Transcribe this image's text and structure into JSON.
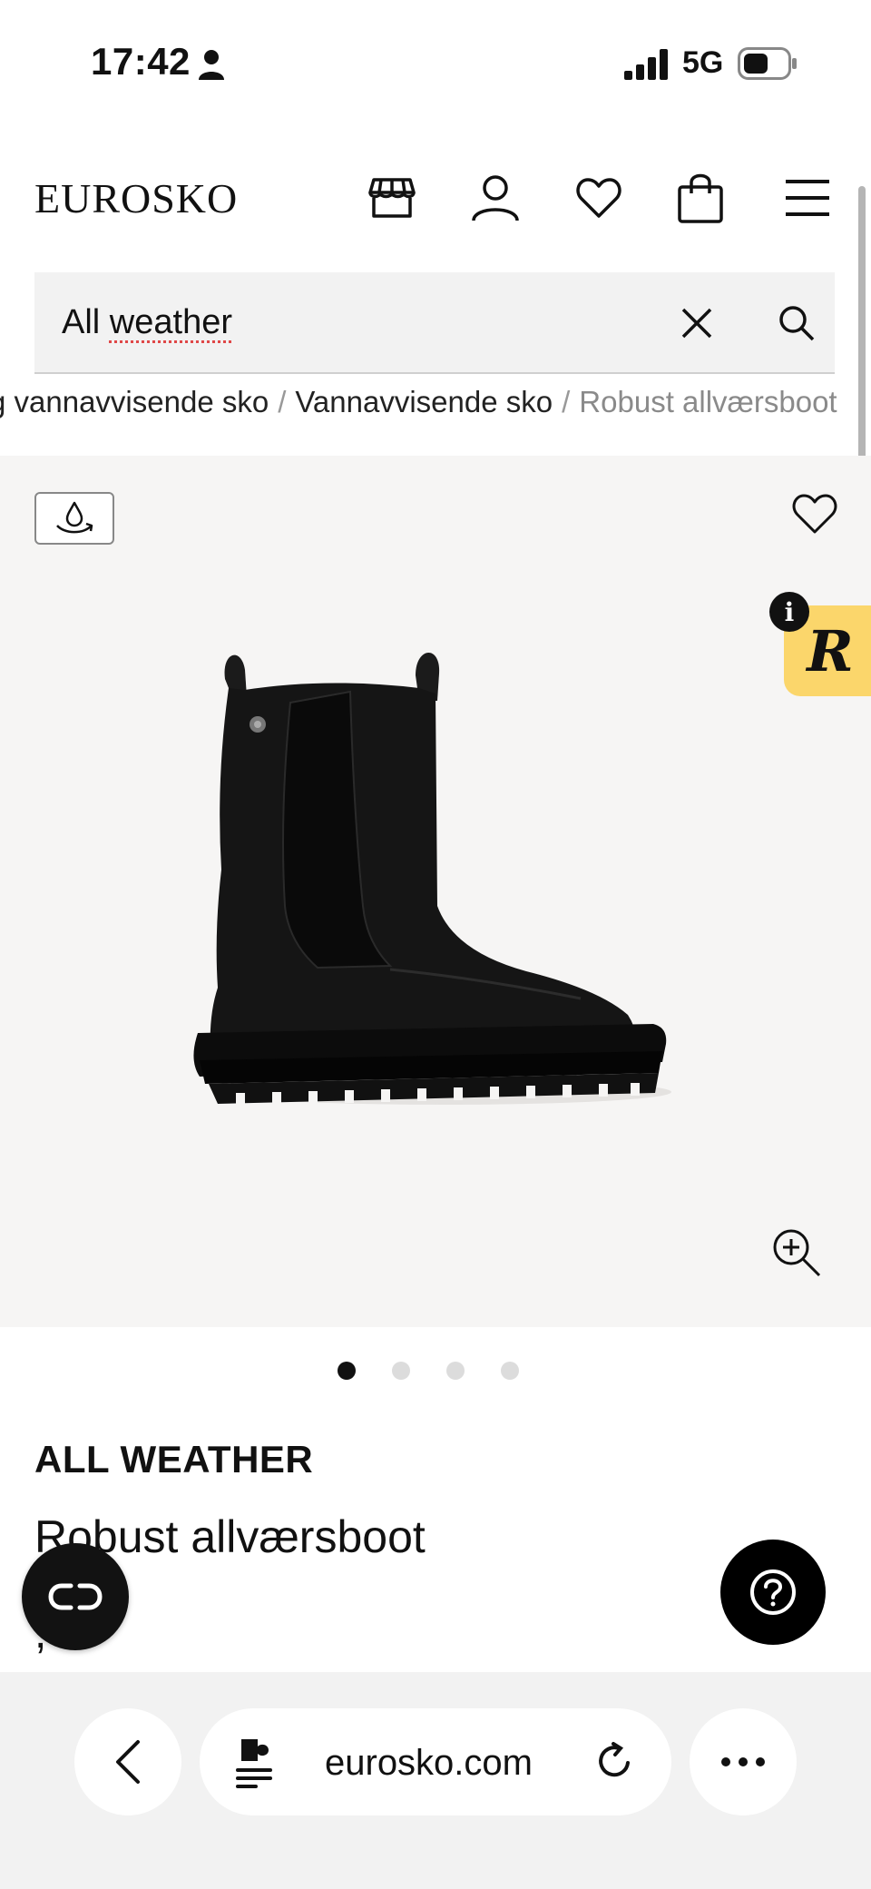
{
  "status_bar": {
    "time": "17:42",
    "network": "5G"
  },
  "header": {
    "logo": "EUROSKO",
    "icons": [
      "store-icon",
      "account-icon",
      "heart-icon",
      "bag-icon",
      "menu-icon"
    ]
  },
  "search": {
    "value_prefix": "All ",
    "value_misspelled": "weather"
  },
  "breadcrumb": {
    "items": [
      "g vannavvisende sko",
      "Vannavvisende sko",
      "Robust allværsboot"
    ],
    "separator": "/"
  },
  "gallery": {
    "badge_icon": "waterproof-icon",
    "review_letter": "R",
    "review_info": "i",
    "slide_count": 4,
    "active_slide": 1
  },
  "product": {
    "brand": "ALL WEATHER",
    "name": "Robust allværsboot",
    "price": "",
    "price_suffix": ",-"
  },
  "browser": {
    "url": "eurosko.com"
  },
  "colors": {
    "review_tab": "#fbd66b",
    "gallery_bg": "#f6f5f4",
    "dark": "#111111"
  }
}
